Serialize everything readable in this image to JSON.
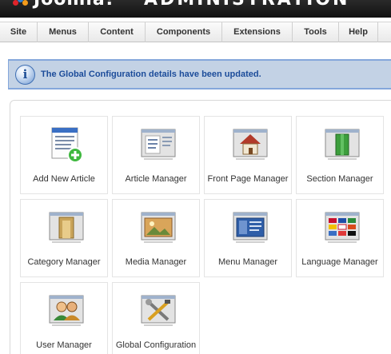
{
  "header": {
    "brand": "Joomla!",
    "site_name": "ADMINISTRATION"
  },
  "menu": [
    {
      "label": "Site"
    },
    {
      "label": "Menus"
    },
    {
      "label": "Content"
    },
    {
      "label": "Components"
    },
    {
      "label": "Extensions"
    },
    {
      "label": "Tools"
    },
    {
      "label": "Help"
    }
  ],
  "message": {
    "icon": "info-icon",
    "text": "The Global Configuration details have been updated."
  },
  "quickicons": [
    {
      "label": "Add New Article",
      "icon": "add-article-icon"
    },
    {
      "label": "Article Manager",
      "icon": "article-manager-icon"
    },
    {
      "label": "Front Page Manager",
      "icon": "front-page-icon"
    },
    {
      "label": "Section Manager",
      "icon": "section-manager-icon"
    },
    {
      "label": "Category Manager",
      "icon": "category-manager-icon"
    },
    {
      "label": "Media Manager",
      "icon": "media-manager-icon"
    },
    {
      "label": "Menu Manager",
      "icon": "menu-manager-icon"
    },
    {
      "label": "Language Manager",
      "icon": "language-manager-icon"
    },
    {
      "label": "User Manager",
      "icon": "user-manager-icon"
    },
    {
      "label": "Global Configuration",
      "icon": "global-configuration-icon"
    }
  ],
  "colors": {
    "message_bg": "#c3d2e5",
    "message_text": "#1c4c9a",
    "header_bg": "#111111"
  }
}
